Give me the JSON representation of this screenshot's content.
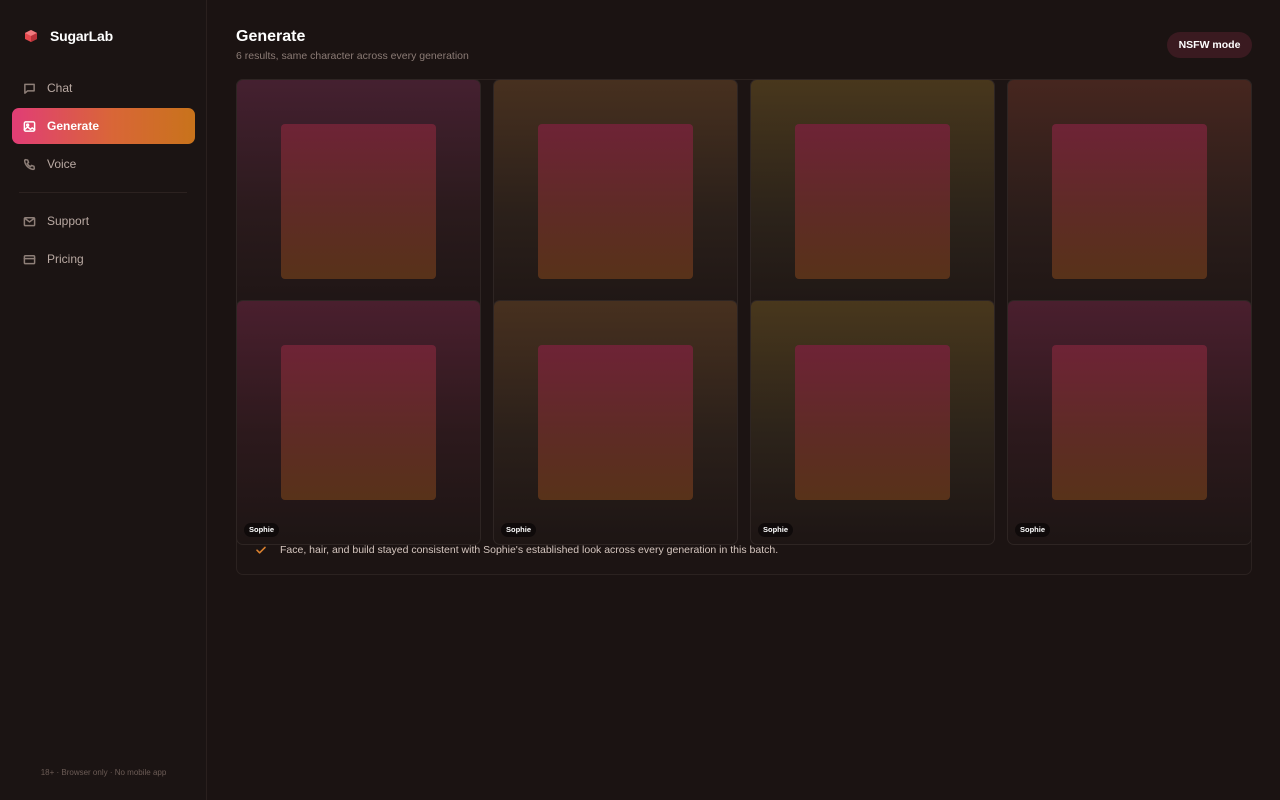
{
  "brand": {
    "name": "SugarLab",
    "logo_icon": "cube-icon",
    "accent": "#e5484d"
  },
  "sidebar": {
    "items": [
      {
        "label": "Chat",
        "icon": "chat-bubble-icon",
        "active": false
      },
      {
        "label": "Generate",
        "icon": "image-icon",
        "active": true
      },
      {
        "label": "Voice",
        "icon": "phone-icon",
        "active": false
      },
      {
        "label": "Support",
        "icon": "mail-icon",
        "active": false
      },
      {
        "label": "Pricing",
        "icon": "credit-card-icon",
        "active": false
      }
    ],
    "footnote": "18+ · Browser only · No mobile app",
    "active_gradient": [
      "#e13d76",
      "#c8731b"
    ]
  },
  "header": {
    "title": "Generate",
    "subtitle": "6 results, same character across every generation",
    "nsfw_label": "NSFW mode"
  },
  "results": {
    "cards": [
      {
        "caption": ""
      },
      {
        "caption": ""
      },
      {
        "caption": ""
      },
      {
        "caption": ""
      },
      {
        "caption": "Sophie"
      },
      {
        "caption": "Sophie"
      },
      {
        "caption": "Sophie"
      },
      {
        "caption": "Sophie"
      }
    ],
    "consistency_note": "Face, hair, and build stayed consistent with Sophie's established look across every generation in this batch.",
    "note_icon": "check-icon"
  }
}
